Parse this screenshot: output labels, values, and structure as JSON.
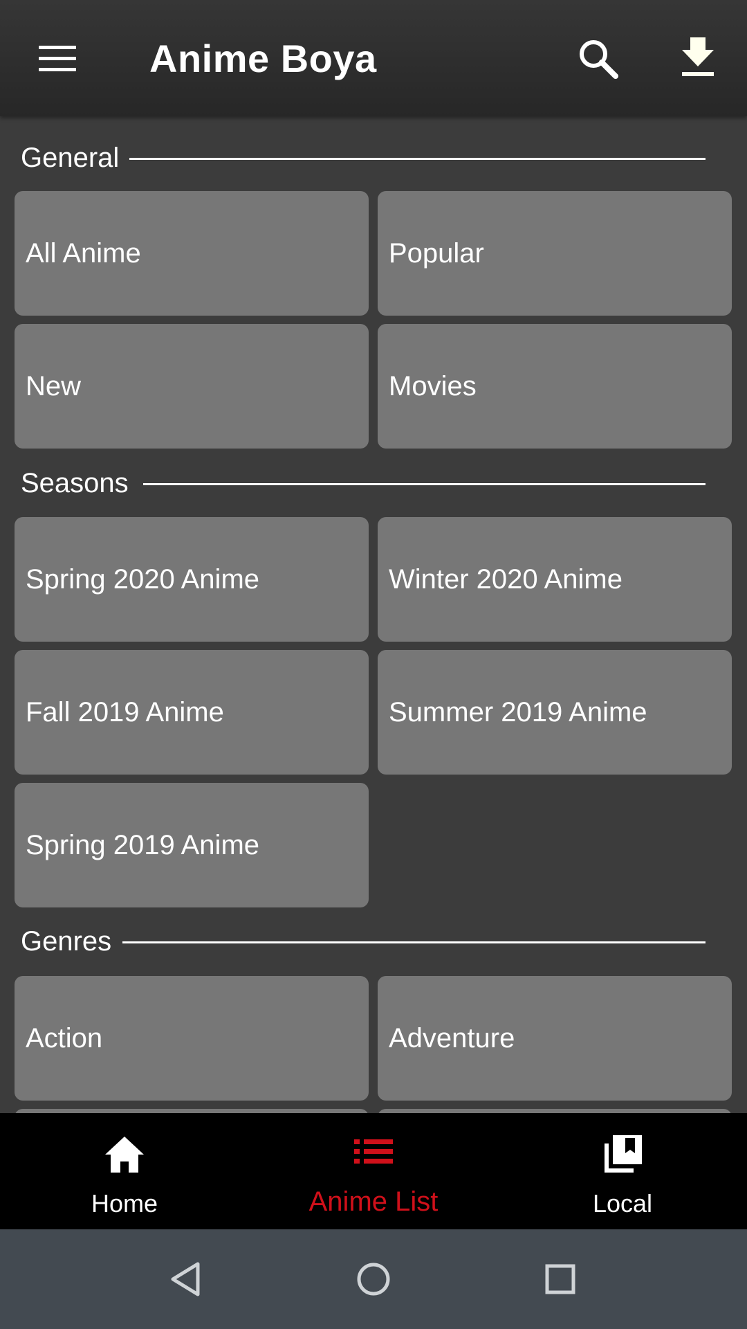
{
  "app_bar": {
    "title": "Anime Boya",
    "menu_icon": "menu-icon",
    "search_icon": "search-icon",
    "download_icon": "download-icon"
  },
  "sections": {
    "general": {
      "title": "General",
      "items": [
        "All Anime",
        "Popular",
        "New",
        "Movies"
      ]
    },
    "seasons": {
      "title": "Seasons",
      "items": [
        "Spring 2020 Anime",
        "Winter 2020 Anime",
        "Fall 2019 Anime",
        "Summer 2019 Anime",
        "Spring 2019 Anime"
      ]
    },
    "genres": {
      "title": "Genres",
      "items": [
        "Action",
        "Adventure"
      ]
    }
  },
  "bottom_nav": {
    "items": [
      {
        "label": "Home",
        "icon": "home-icon"
      },
      {
        "label": "Anime List",
        "icon": "list-icon",
        "active": true
      },
      {
        "label": "Local",
        "icon": "library-icon"
      }
    ]
  },
  "colors": {
    "accent": "#d0101a",
    "app_bar": "#2d2d2d",
    "background": "#3c3c3c",
    "tile": "#777777",
    "bottom_nav": "#000000",
    "system_nav": "#434a51"
  }
}
